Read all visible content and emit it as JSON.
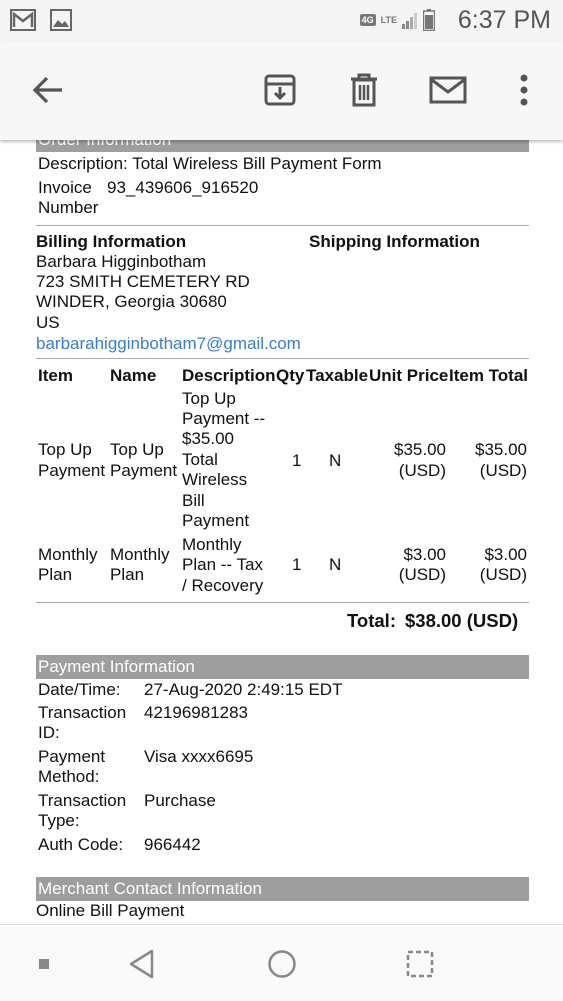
{
  "status": {
    "time": "6:37 PM",
    "network_badge": "4G",
    "lte": "LTE"
  },
  "order": {
    "header": "Order Information",
    "description_label": "Description:",
    "description_value": "Total Wireless Bill Payment Form",
    "invoice_label_1": "Invoice",
    "invoice_label_2": "Number",
    "invoice_value": "93_439606_916520"
  },
  "billing": {
    "title": "Billing Information",
    "name": "Barbara Higginbotham",
    "street": "723 SMITH CEMETERY RD",
    "city": "WINDER, Georgia 30680",
    "country": "US",
    "email": "barbarahigginbotham7@gmail.com"
  },
  "shipping": {
    "title": "Shipping Information"
  },
  "items": {
    "headers": [
      "Item",
      "Name",
      "Description",
      "Qty",
      "Taxable",
      "Unit Price",
      "Item Total"
    ],
    "rows": [
      {
        "item": [
          "Top Up",
          "Payment"
        ],
        "name": [
          "Top Up",
          "Payment"
        ],
        "description": [
          "Top Up",
          "Payment --",
          "$35.00",
          "Total",
          "Wireless",
          "Bill",
          "Payment"
        ],
        "qty": "1",
        "taxable": "N",
        "unit_price": [
          "$35.00",
          "(USD)"
        ],
        "item_total": [
          "$35.00",
          "(USD)"
        ]
      },
      {
        "item": [
          "Monthly",
          "Plan"
        ],
        "name": [
          "Monthly",
          "Plan"
        ],
        "description": [
          "Monthly",
          "Plan -- Tax",
          "/ Recovery"
        ],
        "qty": "1",
        "taxable": "N",
        "unit_price": [
          "$3.00",
          "(USD)"
        ],
        "item_total": [
          "$3.00",
          "(USD)"
        ]
      }
    ],
    "total_label": "Total:",
    "total_value": "$38.00 (USD)"
  },
  "payment": {
    "header": "Payment Information",
    "datetime_label": "Date/Time:",
    "datetime_value": "27-Aug-2020 2:49:15 EDT",
    "txid_label_1": "Transaction",
    "txid_label_2": "ID:",
    "txid_value": "42196981283",
    "method_label_1": "Payment",
    "method_label_2": "Method:",
    "method_value": "Visa xxxx6695",
    "type_label_1": "Transaction",
    "type_label_2": "Type:",
    "type_value": "Purchase",
    "auth_label": "Auth Code:",
    "auth_value": "966442"
  },
  "merchant": {
    "header": "Merchant Contact Information",
    "line1": "Online Bill Payment"
  }
}
